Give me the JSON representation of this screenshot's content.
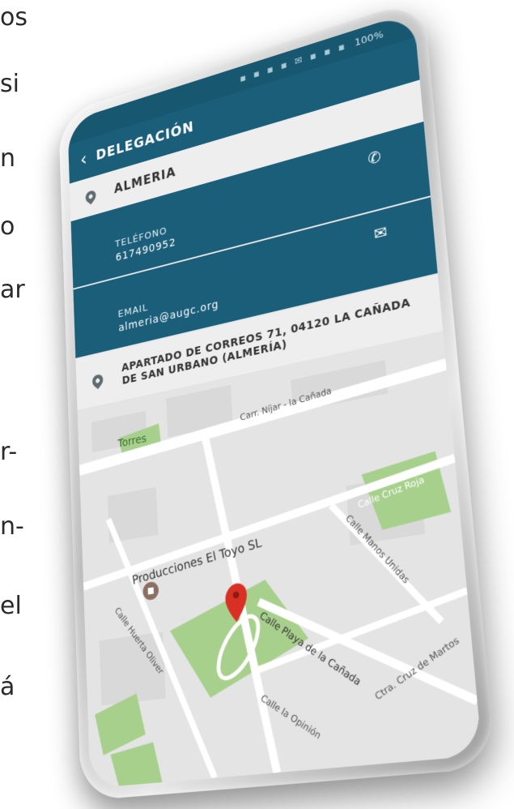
{
  "background_text": [
    "os",
    "si",
    "n",
    "o",
    "ar",
    "r-",
    "n-",
    "el",
    "á"
  ],
  "status_bar": {
    "icons": "▪ ▪ ▪ ▪ ✉ ▪ ▪ ▪",
    "battery": "100%"
  },
  "app_bar": {
    "back_icon": "chevron-left-icon",
    "title": "DELEGACIÓN"
  },
  "delegation": {
    "city": "ALMERIA",
    "phone": {
      "label": "TELÉFONO",
      "value": "617490952",
      "icon": "phone-icon"
    },
    "email": {
      "label": "EMAIL",
      "value": "almeria@augc.org",
      "icon": "envelope-icon"
    },
    "address": "APARTADO DE CORREOS 71, 04120 LA CAÑADA DE SAN URBANO (ALMERÍA)"
  },
  "map": {
    "labels": {
      "torres": "Torres",
      "carr_nijar": "Carr. Níjar - la Cañada",
      "producciones": "Producciones El Toyo SL",
      "calle_cruz_roja": "Calle Cruz Roja",
      "calle_manos_unidas": "Calle Manos Unidas",
      "calle_huerta_oliver": "Calle Huerta Oliver",
      "calle_playa": "Calle Playa de la Cañada",
      "calle_opinion": "Calle la Opinión",
      "ctra_cruz_martos": "Ctra. Cruz de Martos"
    }
  },
  "colors": {
    "brand_blue": "#1b5e7a",
    "map_green": "#a8d08d",
    "marker_red": "#d93025"
  }
}
